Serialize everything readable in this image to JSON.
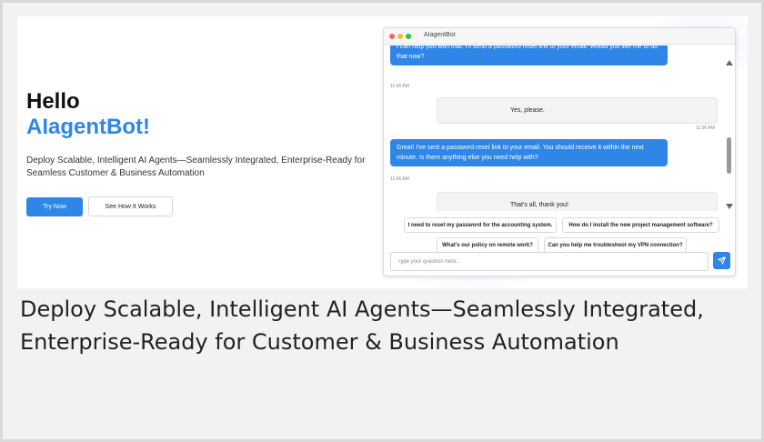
{
  "hero": {
    "title_line1": "Hello",
    "title_line2": "AIagentBot!",
    "subtitle": "Deploy Scalable, Intelligent AI Agents—Seamlessly Integrated, Enterprise-Ready for Seamless Customer & Business Automation",
    "primary_button": "Try Now",
    "secondary_button": "See How It Works"
  },
  "chat": {
    "window_title": "AIagentBot",
    "messages": [
      {
        "role": "bot",
        "text": "I can help you with that. I'll send a password reset link to your email. Would you like me to do that now?",
        "time": "11:06 AM"
      },
      {
        "role": "user",
        "text": "Yes, please.",
        "time": "11:06 AM"
      },
      {
        "role": "bot",
        "text": "Great! I've sent a password reset link to your email. You should receive it within the next minute. Is there anything else you need help with?",
        "time": "11:06 AM"
      },
      {
        "role": "user",
        "text": "That's all, thank you!",
        "time": ""
      }
    ],
    "suggestions": [
      "I need to reset my password for the accounting system.",
      "How do I install the new project management software?",
      "What's our policy on remote work?",
      "Can you help me troubleshoot my VPN connection?"
    ],
    "input_placeholder": "Type your question here...",
    "send_icon": "paper-plane-icon"
  },
  "caption": "Deploy Scalable, Intelligent AI Agents—Seamlessly Integrated, Enterprise-Ready for Customer & Business Automation",
  "colors": {
    "accent": "#2f86e6",
    "heading": "#111111",
    "bubble_user": "#f3f3f3",
    "page_background": "#f2f2f2"
  }
}
